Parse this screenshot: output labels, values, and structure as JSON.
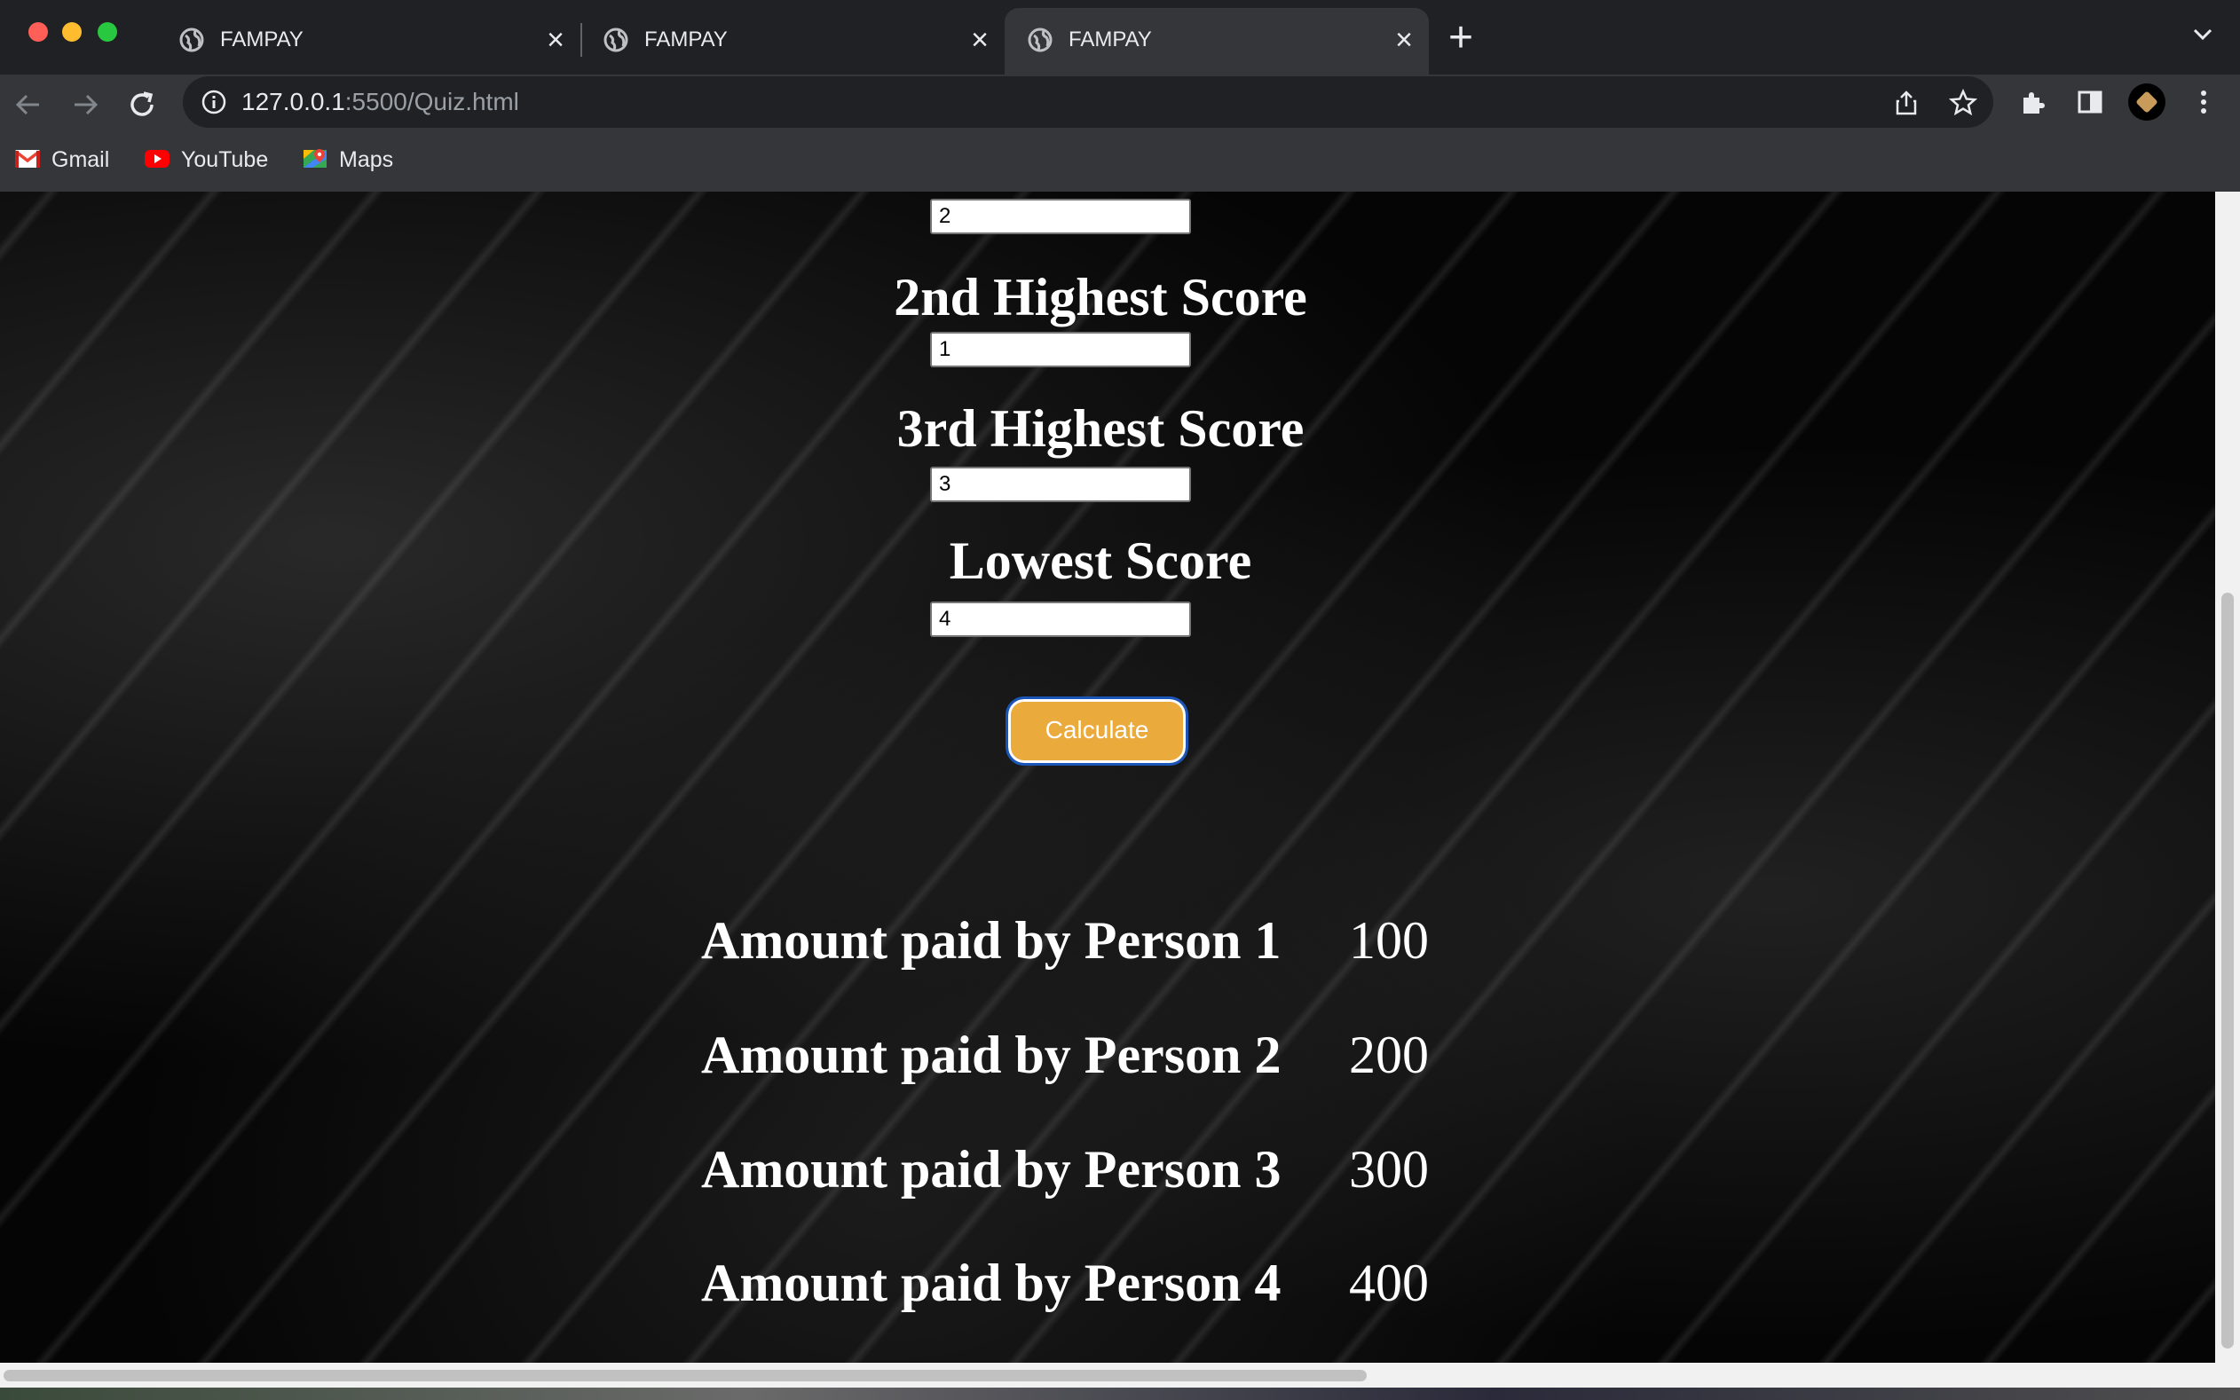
{
  "tabs": [
    {
      "title": "FAMPAY",
      "active": false
    },
    {
      "title": "FAMPAY",
      "active": false
    },
    {
      "title": "FAMPAY",
      "active": true
    }
  ],
  "address_bar": {
    "host": "127.0.0.1",
    "rest": ":5500/Quiz.html"
  },
  "bookmarks": [
    {
      "label": "Gmail",
      "icon": "gmail-icon"
    },
    {
      "label": "YouTube",
      "icon": "youtube-icon"
    },
    {
      "label": "Maps",
      "icon": "maps-icon"
    }
  ],
  "form": {
    "highest_value": "2",
    "second_label": "2nd Highest Score",
    "second_value": "1",
    "third_label": "3rd Highest Score",
    "third_value": "3",
    "lowest_label": "Lowest Score",
    "lowest_value": "4",
    "calculate_label": "Calculate"
  },
  "results": [
    {
      "label": "Amount paid by Person 1",
      "value": "100"
    },
    {
      "label": "Amount paid by Person 2",
      "value": "200"
    },
    {
      "label": "Amount paid by Person 3",
      "value": "300"
    },
    {
      "label": "Amount paid by Person 4",
      "value": "400"
    }
  ],
  "colors": {
    "tabbar": "#202124",
    "toolbar": "#35363a",
    "calculate_button": "#eaaa3c",
    "page_background": "#050505"
  }
}
